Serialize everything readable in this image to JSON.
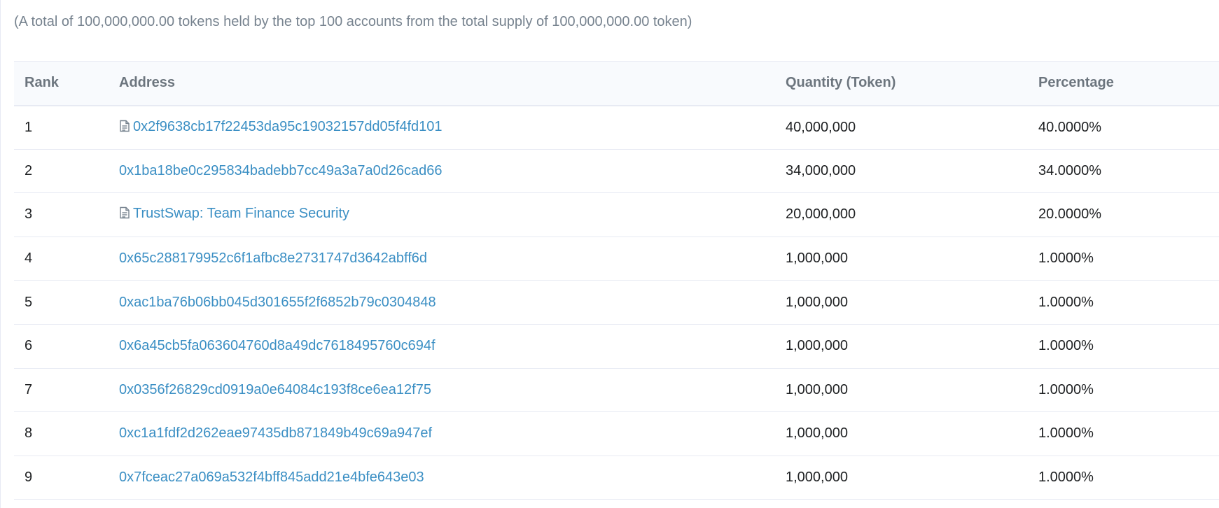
{
  "summary": "(A total of 100,000,000.00 tokens held by the top 100 accounts from the total supply of 100,000,000.00 token)",
  "table": {
    "headers": {
      "rank": "Rank",
      "address": "Address",
      "quantity": "Quantity (Token)",
      "percentage": "Percentage"
    },
    "rows": [
      {
        "rank": "1",
        "address": "0x2f9638cb17f22453da95c19032157dd05f4fd101",
        "is_contract": true,
        "quantity": "40,000,000",
        "percentage": "40.0000%"
      },
      {
        "rank": "2",
        "address": "0x1ba18be0c295834badebb7cc49a3a7a0d26cad66",
        "is_contract": false,
        "quantity": "34,000,000",
        "percentage": "34.0000%"
      },
      {
        "rank": "3",
        "address": "TrustSwap: Team Finance Security",
        "is_contract": true,
        "quantity": "20,000,000",
        "percentage": "20.0000%"
      },
      {
        "rank": "4",
        "address": "0x65c288179952c6f1afbc8e2731747d3642abff6d",
        "is_contract": false,
        "quantity": "1,000,000",
        "percentage": "1.0000%"
      },
      {
        "rank": "5",
        "address": "0xac1ba76b06bb045d301655f2f6852b79c0304848",
        "is_contract": false,
        "quantity": "1,000,000",
        "percentage": "1.0000%"
      },
      {
        "rank": "6",
        "address": "0x6a45cb5fa063604760d8a49dc7618495760c694f",
        "is_contract": false,
        "quantity": "1,000,000",
        "percentage": "1.0000%"
      },
      {
        "rank": "7",
        "address": "0x0356f26829cd0919a0e64084c193f8ce6ea12f75",
        "is_contract": false,
        "quantity": "1,000,000",
        "percentage": "1.0000%"
      },
      {
        "rank": "8",
        "address": "0xc1a1fdf2d262eae97435db871849b49c69a947ef",
        "is_contract": false,
        "quantity": "1,000,000",
        "percentage": "1.0000%"
      },
      {
        "rank": "9",
        "address": "0x7fceac27a069a532f4bff845add21e4bfe643e03",
        "is_contract": false,
        "quantity": "1,000,000",
        "percentage": "1.0000%"
      }
    ]
  },
  "icons": {
    "contract": "file-text-icon"
  },
  "colors": {
    "link": "#3b8fc4",
    "muted_text": "#77838f",
    "header_bg": "#f8fafd",
    "border": "#e7eaf3"
  }
}
